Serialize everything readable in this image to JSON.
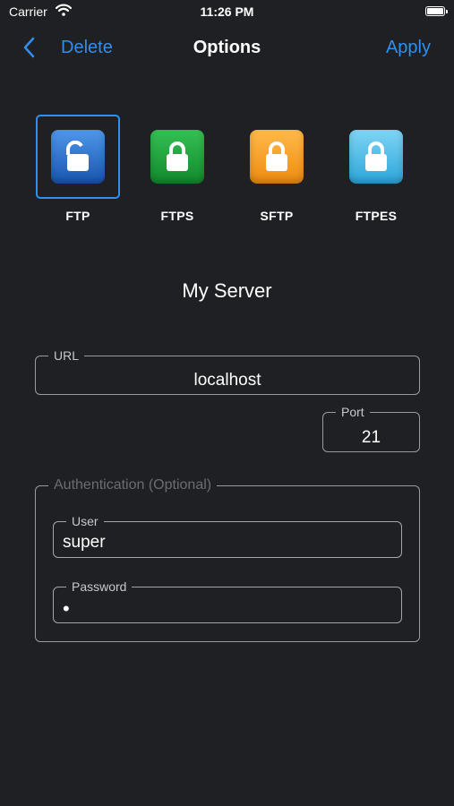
{
  "status_bar": {
    "carrier": "Carrier",
    "time": "11:26 PM"
  },
  "nav": {
    "back_label": "Delete",
    "title": "Options",
    "apply_label": "Apply"
  },
  "protocols": [
    {
      "label": "FTP",
      "color": "#2d74d0",
      "icon": "lock-open-icon",
      "selected": true
    },
    {
      "label": "FTPS",
      "color": "#1fa63f",
      "icon": "lock-icon",
      "selected": false
    },
    {
      "label": "SFTP",
      "color": "#f7a128",
      "icon": "lock-icon",
      "selected": false
    },
    {
      "label": "FTPES",
      "color": "#4ebde9",
      "icon": "lock-icon",
      "selected": false
    }
  ],
  "server": {
    "name": "My Server"
  },
  "url_field": {
    "label": "URL",
    "value": "localhost"
  },
  "port_field": {
    "label": "Port",
    "value": "21"
  },
  "auth": {
    "title": "Authentication (Optional)",
    "user": {
      "label": "User",
      "value": "super"
    },
    "password": {
      "label": "Password",
      "masked_value": "•"
    }
  },
  "colors": {
    "accent": "#2f8ff0",
    "background": "#1f2023",
    "field_border": "#9a9aa0"
  }
}
